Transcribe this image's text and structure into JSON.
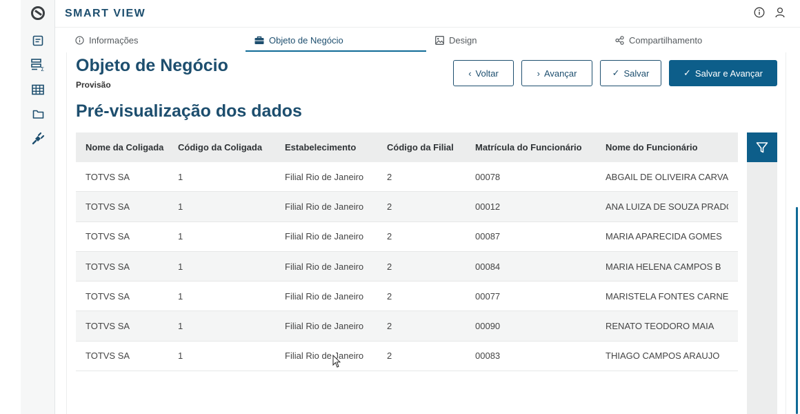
{
  "app": {
    "title": "SMART VIEW"
  },
  "sidebar": {
    "icons": [
      "logo-icon",
      "list-icon",
      "report-icon",
      "table-icon",
      "folder-icon",
      "plugin-icon"
    ]
  },
  "tabs": [
    {
      "label": "Informações",
      "icon": "info-icon",
      "active": false
    },
    {
      "label": "Objeto de Negócio",
      "icon": "briefcase-icon",
      "active": true
    },
    {
      "label": "Design",
      "icon": "image-icon",
      "active": false
    },
    {
      "label": "Compartilhamento",
      "icon": "share-icon",
      "active": false
    }
  ],
  "header": {
    "title": "Objeto de Negócio",
    "subtitle": "Provisão"
  },
  "buttons": {
    "back": "Voltar",
    "next": "Avançar",
    "save": "Salvar",
    "save_next": "Salvar e Avançar"
  },
  "preview": {
    "title": "Pré-visualização dos dados"
  },
  "table": {
    "columns": [
      "Nome da Coligada",
      "Código da Coligada",
      "Estabelecimento",
      "Código da Filial",
      "Matrícula do Funcionário",
      "Nome do Funcionário"
    ],
    "rows": [
      [
        "TOTVS SA",
        "1",
        "Filial Rio de Janeiro",
        "2",
        "00078",
        "ABGAIL DE OLIVEIRA CARVALHO"
      ],
      [
        "TOTVS SA",
        "1",
        "Filial Rio de Janeiro",
        "2",
        "00012",
        "ANA LUIZA DE SOUZA PRADO"
      ],
      [
        "TOTVS SA",
        "1",
        "Filial Rio de Janeiro",
        "2",
        "00087",
        "MARIA APARECIDA GOMES"
      ],
      [
        "TOTVS SA",
        "1",
        "Filial Rio de Janeiro",
        "2",
        "00084",
        "MARIA HELENA CAMPOS B"
      ],
      [
        "TOTVS SA",
        "1",
        "Filial Rio de Janeiro",
        "2",
        "00077",
        "MARISTELA FONTES CARNEIRO"
      ],
      [
        "TOTVS SA",
        "1",
        "Filial Rio de Janeiro",
        "2",
        "00090",
        "RENATO TEODORO MAIA"
      ],
      [
        "TOTVS SA",
        "1",
        "Filial Rio de Janeiro",
        "2",
        "00083",
        "THIAGO CAMPOS ARAUJO"
      ]
    ]
  },
  "colors": {
    "brand": "#1d4e6e",
    "primary": "#0d5e8a",
    "header_bg": "#eceded"
  }
}
